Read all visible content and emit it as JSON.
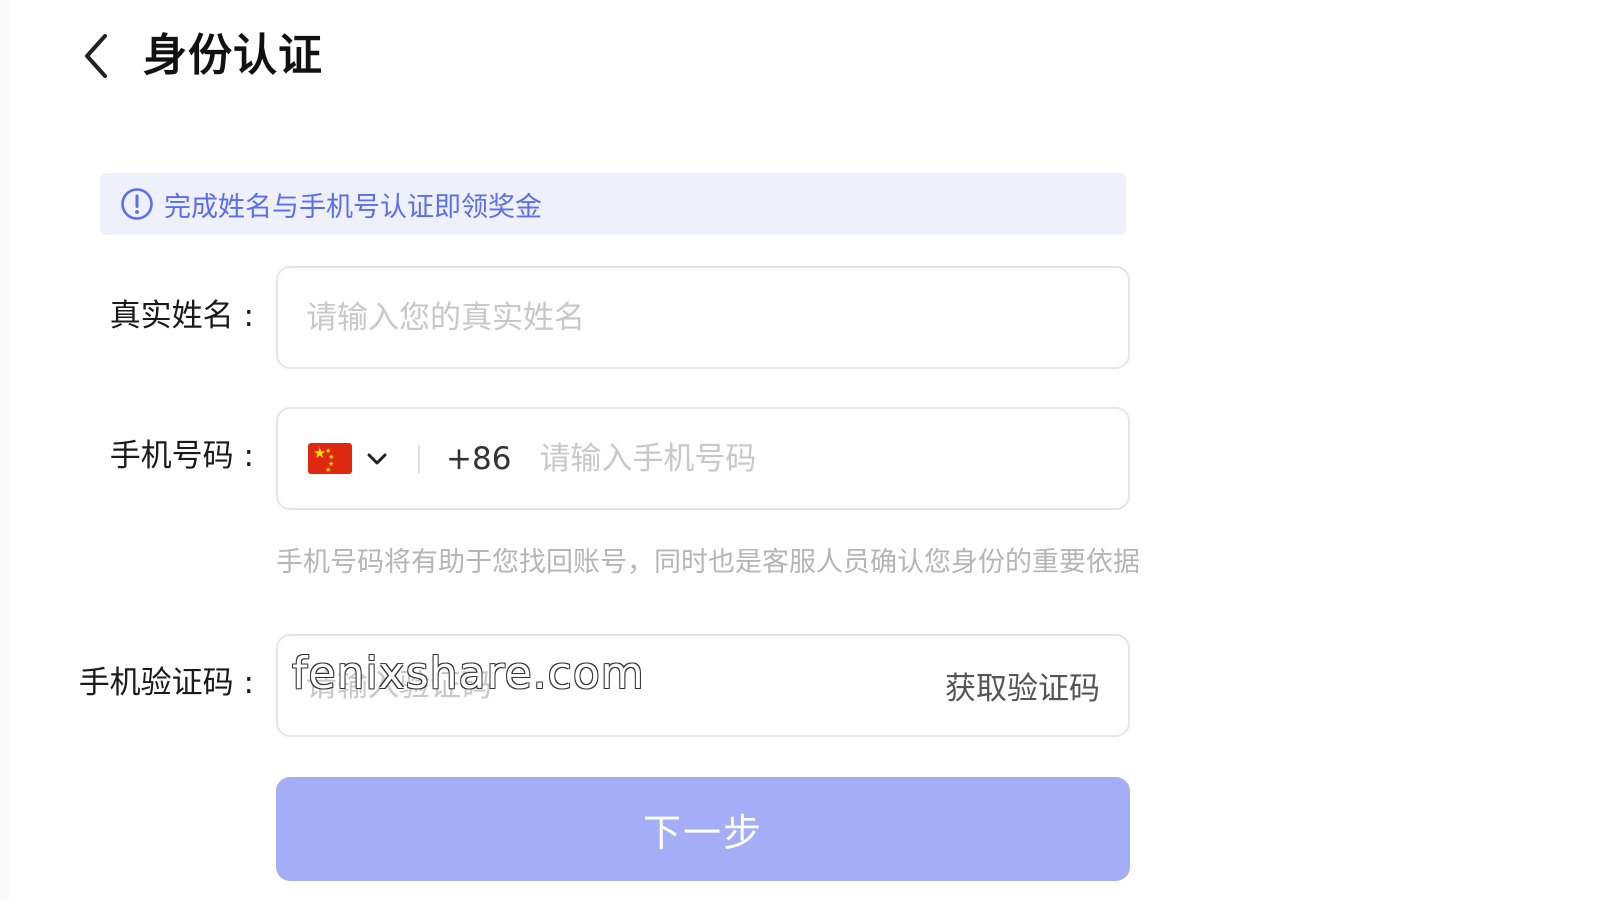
{
  "header": {
    "title": "身份认证",
    "back_icon": "chevron-left-icon"
  },
  "notice": {
    "icon": "info-icon",
    "text": "完成姓名与手机号认证即领奖金",
    "color": "#5c6ef0"
  },
  "form": {
    "name": {
      "label": "真实姓名 :",
      "placeholder": "请输入您的真实姓名",
      "value": ""
    },
    "phone": {
      "label": "手机号码 :",
      "country_flag": "china-flag-icon",
      "dial_code": "+86",
      "placeholder": "请输入手机号码",
      "value": "",
      "hint": "手机号码将有助于您找回账号，同时也是客服人员确认您身份的重要依据"
    },
    "code": {
      "label": "手机验证码 :",
      "placeholder": "请输入验证码",
      "value": "",
      "get_code_label": "获取验证码"
    },
    "submit_label": "下一步",
    "submit_color": "#a4aef7"
  },
  "watermark": "fenixshare.com"
}
